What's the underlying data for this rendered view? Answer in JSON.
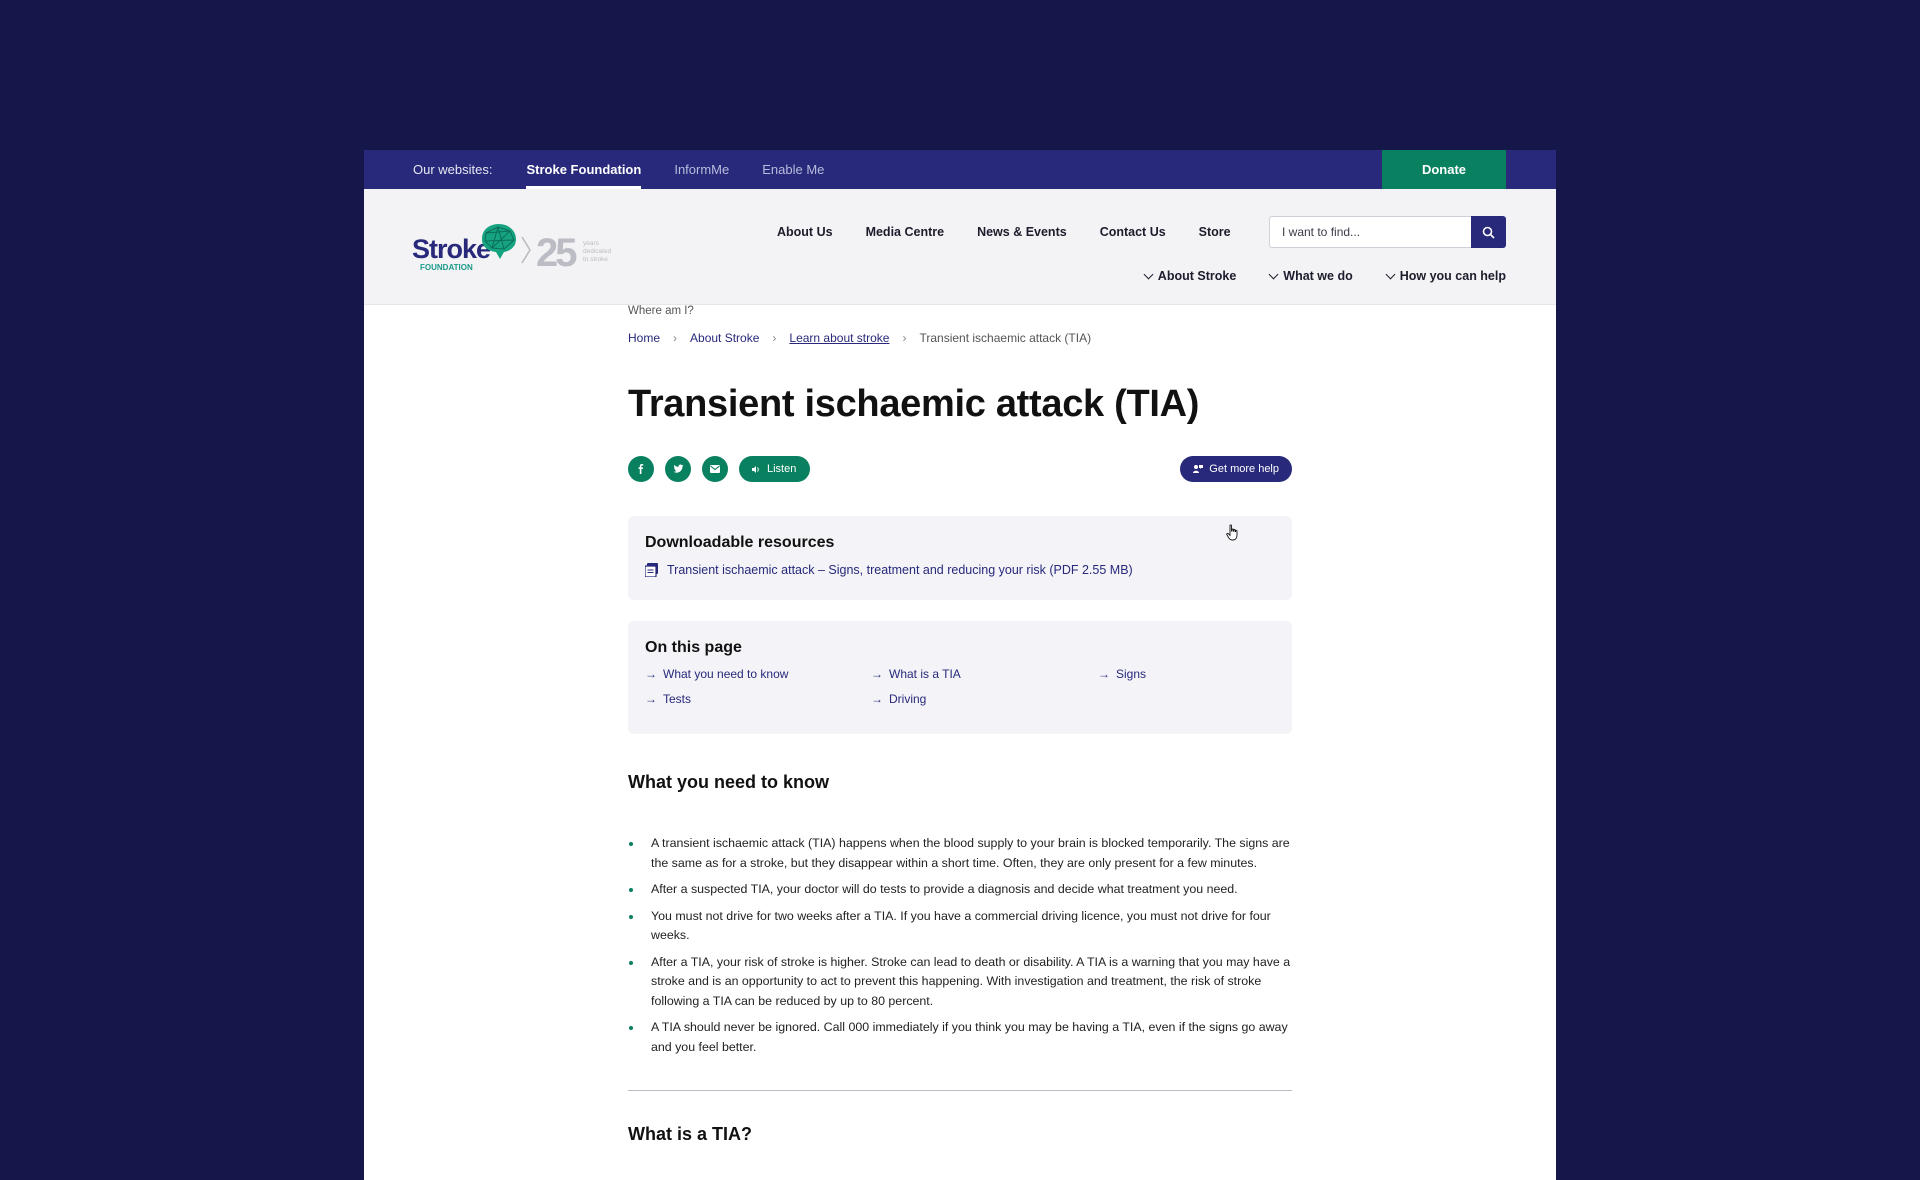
{
  "topbar": {
    "label": "Our websites:",
    "sites": [
      "Stroke Foundation",
      "InformMe",
      "Enable Me"
    ],
    "donate": "Donate"
  },
  "logo": {
    "wordmark": "Stroke",
    "sub": "FOUNDATION",
    "anniversary": "25",
    "tagline": "years dedicated to stroke"
  },
  "nav": {
    "primary": [
      "About Us",
      "Media Centre",
      "News & Events",
      "Contact Us",
      "Store"
    ],
    "search_placeholder": "I want to find...",
    "secondary": [
      "About Stroke",
      "What we do",
      "How you can help"
    ]
  },
  "breadcrumb": {
    "label": "Where am I?",
    "items": [
      "Home",
      "About Stroke",
      "Learn about stroke",
      "Transient ischaemic attack (TIA)"
    ]
  },
  "page": {
    "title": "Transient ischaemic attack (TIA)",
    "listen": "Listen",
    "get_help": "Get more help"
  },
  "downloads": {
    "title": "Downloadable resources",
    "link": "Transient ischaemic attack – Signs, treatment and reducing your risk (PDF 2.55 MB)"
  },
  "on_this_page": {
    "title": "On this page",
    "links": [
      "What you need to know",
      "What is a TIA",
      "Signs",
      "Tests",
      "Driving"
    ]
  },
  "section": {
    "title": "What you need to know",
    "points": [
      "A transient ischaemic attack (TIA) happens when the blood supply to your brain is blocked temporarily. The signs are the same as for a stroke, but they disappear within a short time. Often, they are only present for a few minutes.",
      "After a suspected TIA, your doctor will do tests to provide a diagnosis and decide what treatment you need.",
      "You must not drive for two weeks after a TIA. If you have a commercial driving licence, you must not drive for four weeks.",
      "After a TIA, your risk of stroke is higher. Stroke can lead to death or disability. A TIA is a warning that you may have a stroke and is an opportunity to act to prevent this happening. With investigation and treatment, the risk of stroke following a TIA can be reduced by up to 80 percent.",
      "A TIA should never be ignored. Call 000 immediately if you think you may be having a TIA, even if the signs go away and you feel better."
    ],
    "next_title": "What is a TIA?"
  },
  "colors": {
    "navy": "#28297a",
    "green": "#09805f",
    "background": "#15164a"
  }
}
